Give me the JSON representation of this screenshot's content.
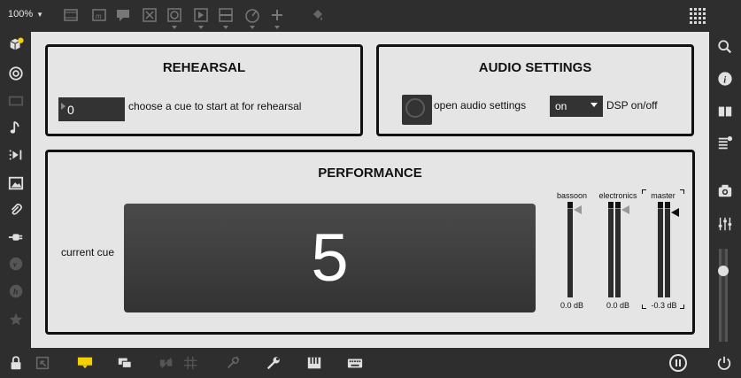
{
  "toolbar": {
    "zoom": "100%",
    "icons": [
      "new-object-icon",
      "message-icon",
      "comment-icon",
      "toggle-icon",
      "button-icon",
      "slider-icon",
      "number-icon",
      "dial-icon",
      "add-icon",
      "paint-bucket-icon",
      "grid-icon"
    ]
  },
  "rehearsal": {
    "title": "REHEARSAL",
    "cue_value": "0",
    "cue_label": "choose a cue to start at for rehearsal"
  },
  "audio": {
    "title": "AUDIO SETTINGS",
    "open_label": "open audio settings",
    "dsp_value": "on",
    "dsp_label": "DSP on/off"
  },
  "performance": {
    "title": "PERFORMANCE",
    "current_cue_label": "current cue",
    "current_cue_value": "5",
    "meters": [
      {
        "name": "bassoon",
        "value": "0.0 dB"
      },
      {
        "name": "electronics",
        "value": "0.0 dB"
      },
      {
        "name": "master",
        "value": "-0.3 dB"
      }
    ]
  },
  "colors": {
    "accent_yellow": "#f5d000",
    "canvas_bg": "#e5e5e5",
    "chrome_bg": "#2e2e2e",
    "display_bg": "#3c3c3c"
  }
}
